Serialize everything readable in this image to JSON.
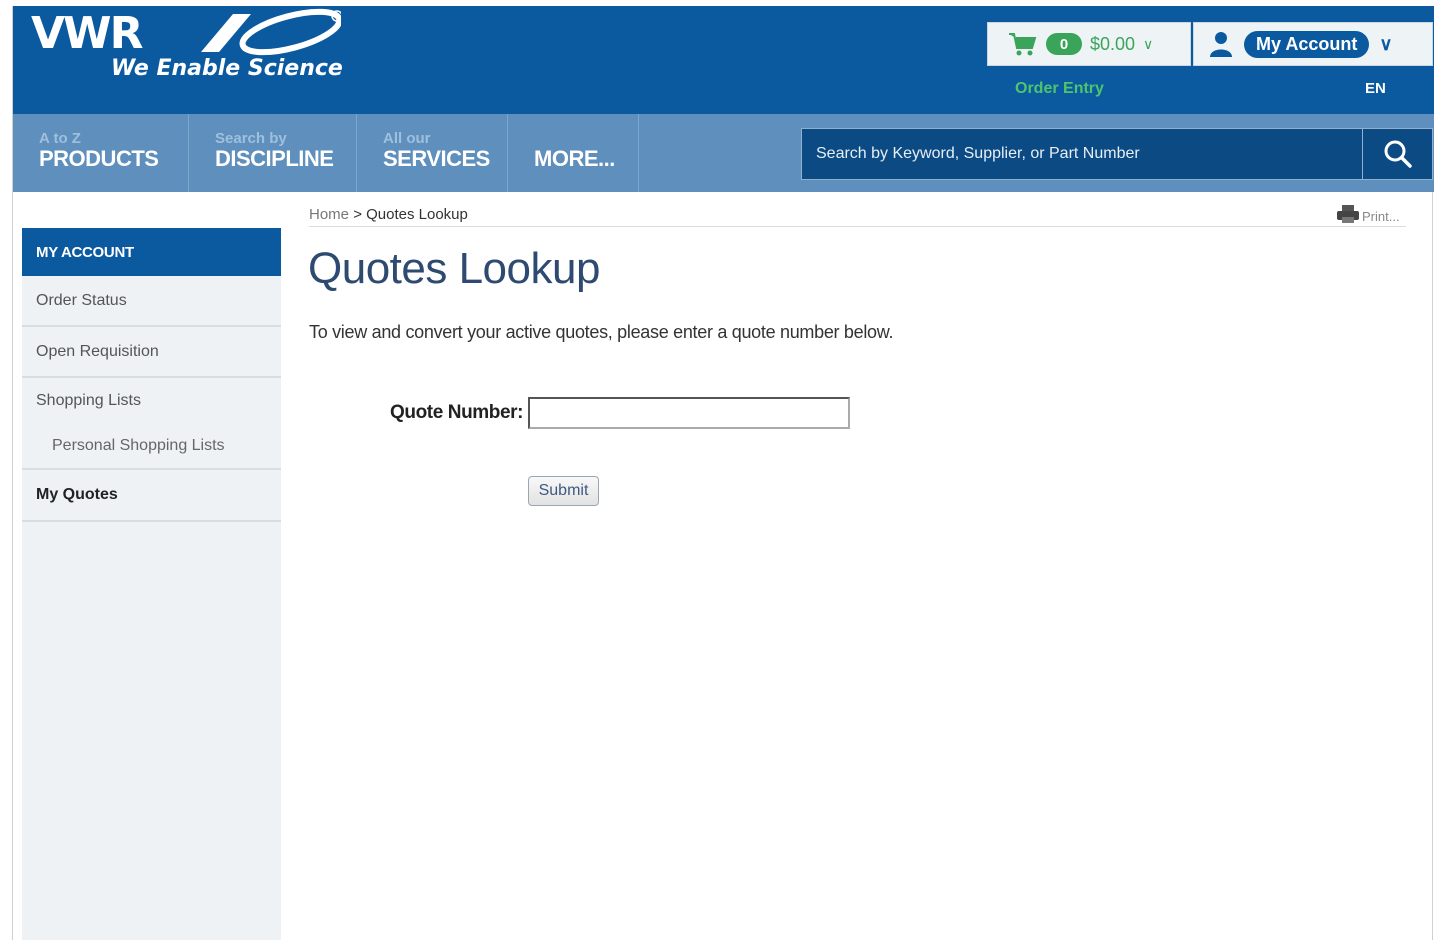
{
  "header": {
    "logo_text": "VWR",
    "tagline": "We Enable Science",
    "cart": {
      "count": "0",
      "total": "$0.00"
    },
    "account_label": "My Account",
    "order_entry": "Order Entry",
    "language": "EN"
  },
  "nav": {
    "items": [
      {
        "small": "A to Z",
        "big": "PRODUCTS"
      },
      {
        "small": "Search by",
        "big": "DISCIPLINE"
      },
      {
        "small": "All our",
        "big": "SERVICES"
      },
      {
        "small": "",
        "big": "MORE..."
      }
    ],
    "search_placeholder": "Search by Keyword, Supplier, or Part Number"
  },
  "sidebar": {
    "heading": "MY ACCOUNT",
    "items": [
      {
        "label": "Order Status"
      },
      {
        "label": "Open Requisition"
      },
      {
        "label": "Shopping Lists"
      },
      {
        "label": "Personal Shopping Lists"
      },
      {
        "label": "My Quotes"
      }
    ]
  },
  "breadcrumb": {
    "home": "Home",
    "separator": ">",
    "current": "Quotes Lookup"
  },
  "print_label": "Print...",
  "main": {
    "title": "Quotes Lookup",
    "intro": "To view and convert your active quotes, please enter a quote number below.",
    "quote_label": "Quote Number:",
    "quote_value": "",
    "submit_label": "Submit"
  },
  "colors": {
    "brand_blue": "#0b5aa0",
    "nav_blue": "#5e8fbd",
    "accent_green": "#3aa55a"
  }
}
